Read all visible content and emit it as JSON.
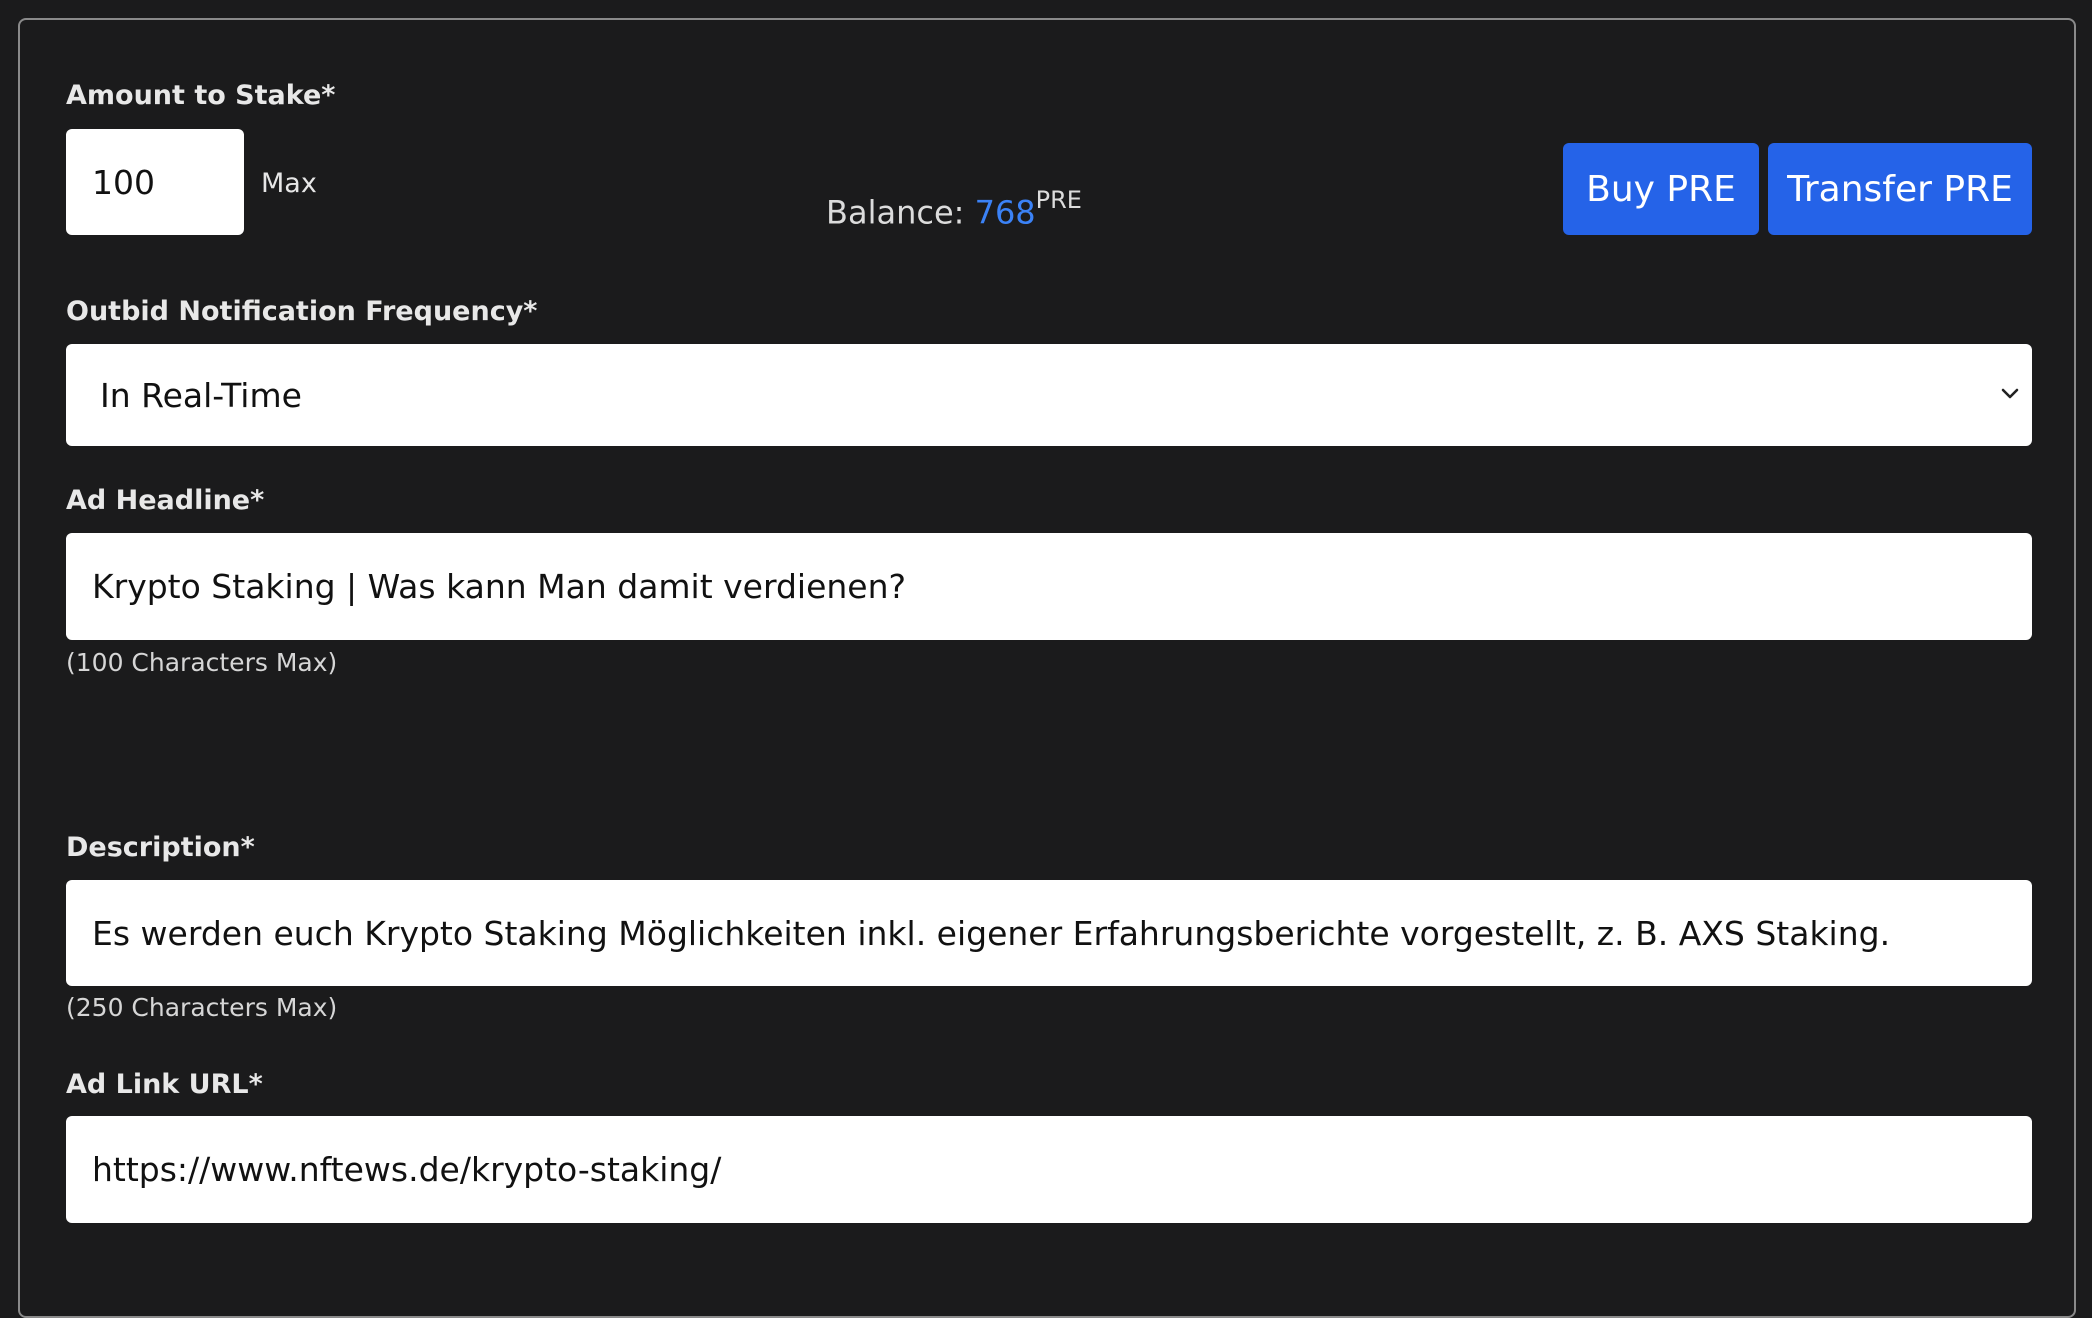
{
  "stake": {
    "label": "Amount to Stake*",
    "value": "100",
    "max_label": "Max",
    "balance_label": "Balance: ",
    "balance_value": "768",
    "balance_unit": "PRE",
    "buy_label": "Buy PRE",
    "transfer_label": "Transfer PRE"
  },
  "notification": {
    "label": "Outbid Notification Frequency*",
    "selected": "In Real-Time"
  },
  "headline": {
    "label": "Ad Headline*",
    "value": "Krypto Staking | Was kann Man damit verdienen?",
    "hint": "(100 Characters Max)"
  },
  "description": {
    "label": "Description*",
    "value": "Es werden euch Krypto Staking Möglichkeiten inkl. eigener Erfahrungsberichte vorgestellt, z. B. AXS Staking.",
    "hint": "(250 Characters Max)"
  },
  "link": {
    "label": "Ad Link URL*",
    "value": "https://www.nftews.de/krypto-staking/"
  },
  "colors": {
    "background": "#1b1b1c",
    "accent": "#2563e8",
    "balance_value": "#3b82f6"
  }
}
